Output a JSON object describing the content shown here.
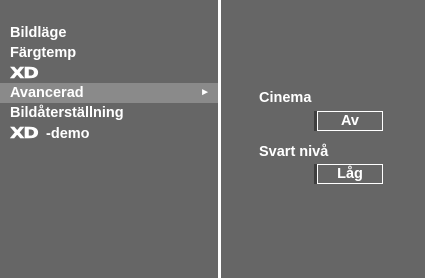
{
  "menu": {
    "items": [
      {
        "label": "Bildläge"
      },
      {
        "label": "Färgtemp"
      },
      {
        "logo": "XD"
      },
      {
        "label": "Avancerad",
        "selected": true,
        "arrow": "►"
      },
      {
        "label": "Bildåterställning"
      },
      {
        "logo": "XD",
        "label": "-demo"
      }
    ]
  },
  "settings": {
    "cinema": {
      "label": "Cinema",
      "value": "Av"
    },
    "svart_niva": {
      "label": "Svart nivå",
      "value": "Låg"
    }
  },
  "colors": {
    "panel": "#666666",
    "highlight": "#8a8a8a",
    "text": "#ffffff",
    "divider": "#ffffff"
  }
}
